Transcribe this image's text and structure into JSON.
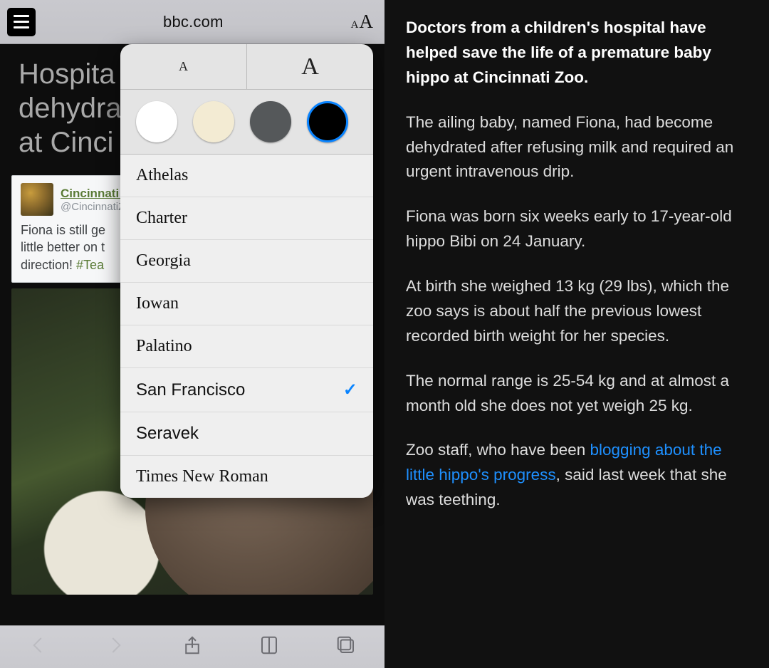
{
  "toolbar": {
    "url": "bbc.com",
    "reader_toggle": "reader-view-button",
    "text_size": "text-size-button"
  },
  "bg_article": {
    "title": "Hospital helps save dehydrated baby hippo at Cincinnati Zoo",
    "title_visible": "Hospita\ndehydra\nat Cinci"
  },
  "tweet": {
    "account_name": "Cincinnati Zoo",
    "account_handle": "@CincinnatiZoo",
    "body_visible": "Fiona is still ge\nlittle better on t\ndirection! #Tea",
    "body_prefix": "Fiona is still ge",
    "body_line2": "little better on t",
    "body_line3_text": "direction! ",
    "body_hashtag": "#Tea"
  },
  "popover": {
    "size_small": "A",
    "size_large": "A",
    "themes": [
      {
        "name": "white",
        "color": "#ffffff",
        "selected": false
      },
      {
        "name": "sepia",
        "color": "#f3ebd3",
        "selected": false
      },
      {
        "name": "gray",
        "color": "#55585a",
        "selected": false
      },
      {
        "name": "black",
        "color": "#000000",
        "selected": true
      }
    ],
    "fonts": [
      {
        "name": "Athelas",
        "class": "font-athelas",
        "selected": false
      },
      {
        "name": "Charter",
        "class": "font-charter",
        "selected": false
      },
      {
        "name": "Georgia",
        "class": "font-georgia",
        "selected": false
      },
      {
        "name": "Iowan",
        "class": "font-iowan",
        "selected": false
      },
      {
        "name": "Palatino",
        "class": "font-palatino",
        "selected": false
      },
      {
        "name": "San Francisco",
        "class": "font-sf",
        "selected": true
      },
      {
        "name": "Seravek",
        "class": "font-seravek",
        "selected": false
      },
      {
        "name": "Times New Roman",
        "class": "font-tnr",
        "selected": false
      }
    ]
  },
  "article": {
    "lead": "Doctors from a children's hospital have helped save the life of a premature baby hippo at Cincinnati Zoo.",
    "p1": "The ailing baby, named Fiona, had become dehydrated after refusing milk and required an urgent intravenous drip.",
    "p2": "Fiona was born six weeks early to 17-year-old hippo Bibi on 24 January.",
    "p3": "At birth she weighed 13 kg (29 lbs), which the zoo says is about half the previous lowest recorded birth weight for her species.",
    "p4": "The normal range is 25-54 kg and at almost a month old she does not yet weigh 25 kg.",
    "p5_a": "Zoo staff, who have been ",
    "p5_link": "blogging about the little hippo's progress",
    "p5_b": ", said last week that she was teething."
  },
  "tabbar": {
    "back": "back",
    "forward": "forward",
    "share": "share",
    "bookmarks": "bookmarks",
    "tabs": "tabs"
  }
}
